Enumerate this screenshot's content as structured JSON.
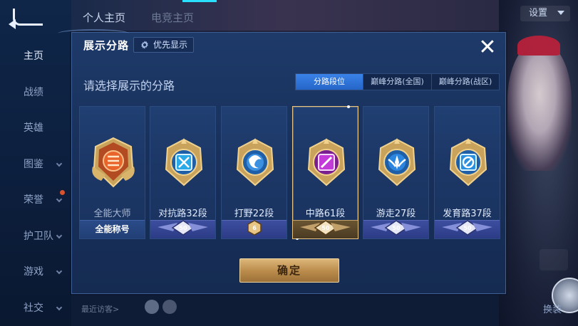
{
  "header": {
    "tab_personal": "个人主页",
    "tab_second": "电竞主页",
    "settings": "设置"
  },
  "sidebar": {
    "items": [
      {
        "label": "主页",
        "active": true
      },
      {
        "label": "战绩",
        "active": false
      },
      {
        "label": "英雄",
        "active": false
      },
      {
        "label": "图鉴",
        "active": false
      },
      {
        "label": "荣誉",
        "active": false
      },
      {
        "label": "护卫队",
        "active": false
      },
      {
        "label": "游戏",
        "active": false
      },
      {
        "label": "社交",
        "active": false
      }
    ]
  },
  "footer": {
    "recent_visitors": "最近访客>",
    "right_button": "换装"
  },
  "modal": {
    "title": "展示分路",
    "priority_button": "优先显示",
    "subheading": "请选择展示的分路",
    "close_icon": "close-icon",
    "tabs": [
      {
        "label": "分路段位",
        "active": true
      },
      {
        "label": "巅峰分路(全国)",
        "active": false
      },
      {
        "label": "巅峰分路(战区)",
        "active": false
      }
    ],
    "cards": [
      {
        "label": "全能大师",
        "badge": "",
        "footer": "全能称号",
        "emblem_color": "#e8642a",
        "selected": false
      },
      {
        "label": "对抗路32段",
        "badge": "50",
        "footer": "",
        "emblem_color": "#2aa9e8",
        "selected": false
      },
      {
        "label": "打野22段",
        "badge": "6",
        "footer": "",
        "emblem_color": "#3b90e0",
        "selected": false
      },
      {
        "label": "中路61段",
        "badge": "50",
        "footer": "",
        "emblem_color": "#c23ad8",
        "selected": true
      },
      {
        "label": "游走27段",
        "badge": "50",
        "footer": "",
        "emblem_color": "#2c86e0",
        "selected": false
      },
      {
        "label": "发育路37段",
        "badge": "50",
        "footer": "",
        "emblem_color": "#2b8fe0",
        "selected": false
      }
    ],
    "confirm_button": "确定"
  },
  "colors": {
    "accent_gold": "#dcb679",
    "tab_active": "#2565c8",
    "modal_bg": "#1c3766",
    "cyan_indicator": "#29e0ff"
  }
}
